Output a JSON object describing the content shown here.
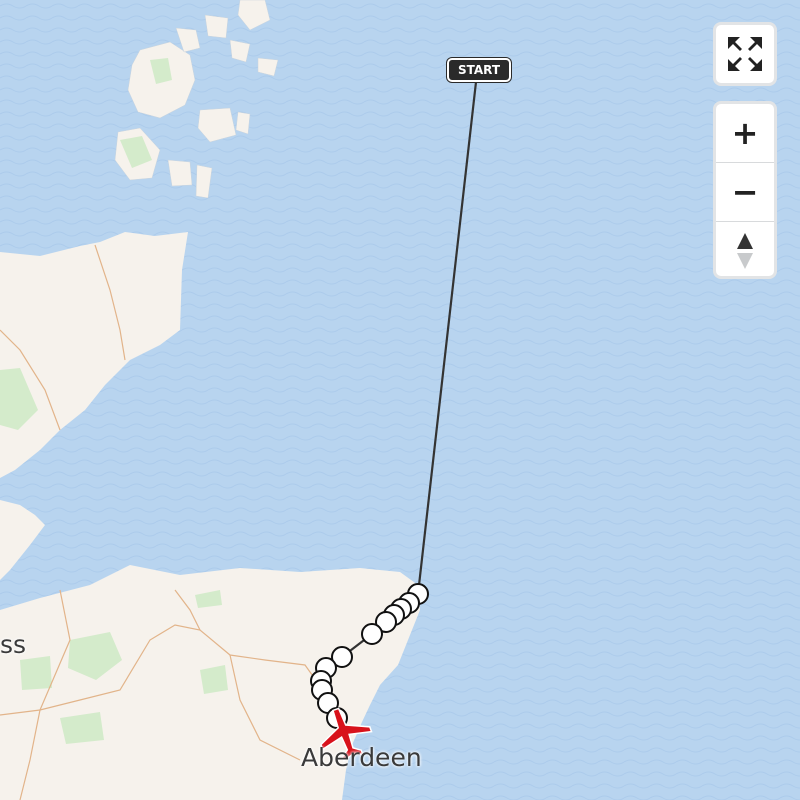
{
  "map": {
    "places": {
      "city": "Aberdeen",
      "partial_town": "ss"
    },
    "track": {
      "start_label": "START",
      "marker_icon": "plane-icon",
      "marker_color": "#d8121b",
      "line_color": "#333333",
      "point_fill": "#ffffff"
    },
    "colors": {
      "sea": "#b8d4ef",
      "land": "#f6f2ec",
      "forest": "#d4ebcb",
      "boundary": "#e2b48a"
    }
  },
  "controls": {
    "fullscreen_icon": "fullscreen-icon",
    "zoom_in_label": "+",
    "zoom_out_label": "−",
    "compass_icon": "compass-icon"
  }
}
